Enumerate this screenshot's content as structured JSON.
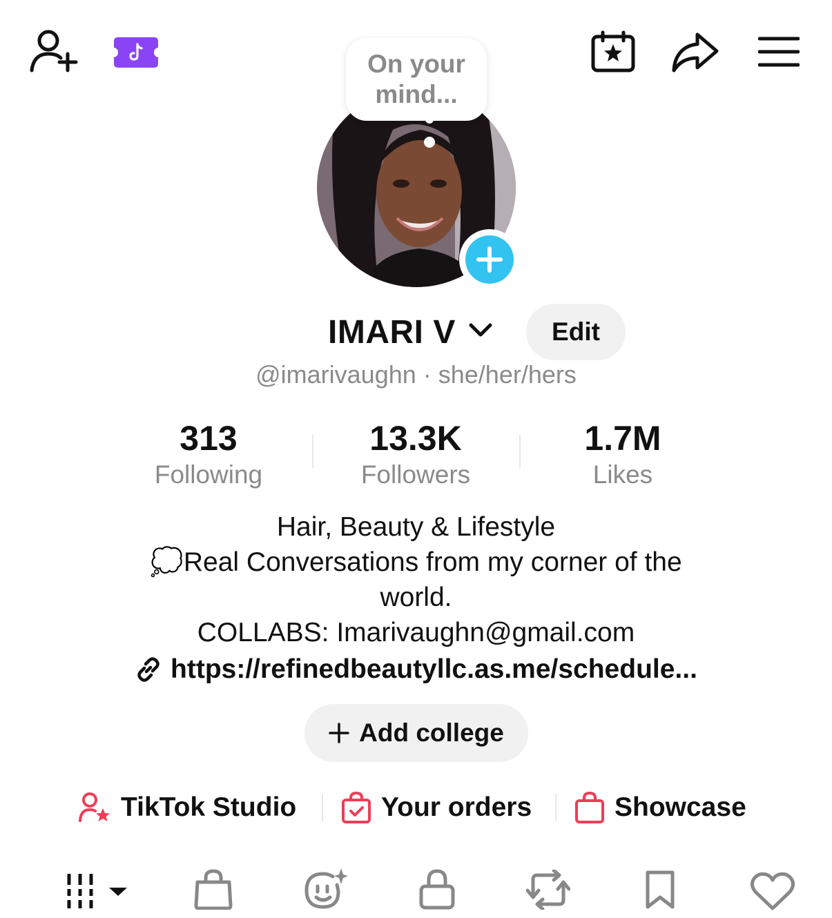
{
  "header": {
    "add_friend_icon": "person-plus-icon",
    "tiktok_badge_icon": "tiktok-ticket-icon",
    "calendar_icon": "calendar-star-icon",
    "share_icon": "share-arrow-icon",
    "menu_icon": "hamburger-menu-icon"
  },
  "avatar": {
    "thought_bubble": [
      "On your",
      "mind..."
    ],
    "add_icon": "plus-icon"
  },
  "profile": {
    "display_name": "IMARI V",
    "edit_label": "Edit",
    "handle": "@imarivaughn · she/her/hers"
  },
  "stats": [
    {
      "value": "313",
      "label": "Following"
    },
    {
      "value": "13.3K",
      "label": "Followers"
    },
    {
      "value": "1.7M",
      "label": "Likes"
    }
  ],
  "bio": {
    "line1": "Hair, Beauty & Lifestyle",
    "line2_emoji": "💭",
    "line2": "Real Conversations from my corner of the",
    "line3": "world.",
    "line4": "COLLABS: Imarivaughn@gmail.com",
    "link": "https://refinedbeautyllc.as.me/schedule..."
  },
  "college": {
    "label": "Add college"
  },
  "quick_links": [
    {
      "label": "TikTok Studio",
      "icon": "studio-person-star-icon"
    },
    {
      "label": "Your orders",
      "icon": "orders-bag-icon"
    },
    {
      "label": "Showcase",
      "icon": "showcase-bag-icon"
    }
  ],
  "tabs": [
    {
      "icon": "videos-grid-icon"
    },
    {
      "icon": "shop-bag-icon"
    },
    {
      "icon": "ai-face-icon"
    },
    {
      "icon": "lock-icon"
    },
    {
      "icon": "repost-icon"
    },
    {
      "icon": "bookmark-icon"
    },
    {
      "icon": "heart-icon"
    }
  ],
  "colors": {
    "accent_blue": "#33c3f0",
    "purple_badge": "#8a44f5",
    "quick_red": "#ee3d57",
    "muted_text": "#8a8a8a"
  }
}
